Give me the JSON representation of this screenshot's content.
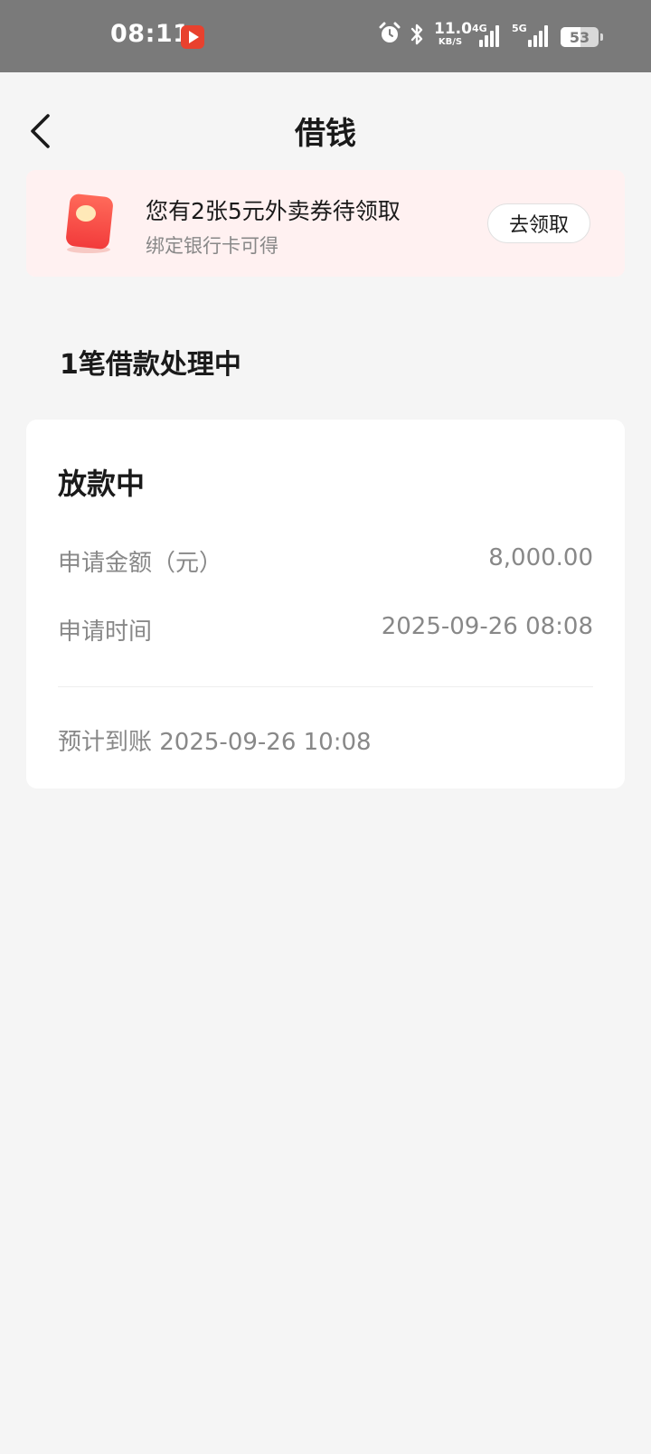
{
  "status_bar": {
    "time": "08:11",
    "net_speed_value": "11.0",
    "net_speed_unit": "KB/S",
    "sim1_label": "4G",
    "sim2_label": "5G",
    "battery_level": "53",
    "battery_percent": 53
  },
  "header": {
    "title": "借钱"
  },
  "promo": {
    "title": "您有2张5元外卖券待领取",
    "subtitle": "绑定银行卡可得",
    "button_label": "去领取"
  },
  "section": {
    "heading": "1笔借款处理中"
  },
  "loan": {
    "status": "放款中",
    "amount_label": "申请金额（元）",
    "amount_value": "8,000.00",
    "time_label": "申请时间",
    "time_value": "2025-09-26 08:08",
    "eta_text": "预计到账 2025-09-26 10:08"
  },
  "colors": {
    "status_bar_bg": "#7a7a7a",
    "page_bg": "#f5f5f5",
    "promo_bg": "#fff1f1",
    "app_badge": "#e8412e"
  }
}
